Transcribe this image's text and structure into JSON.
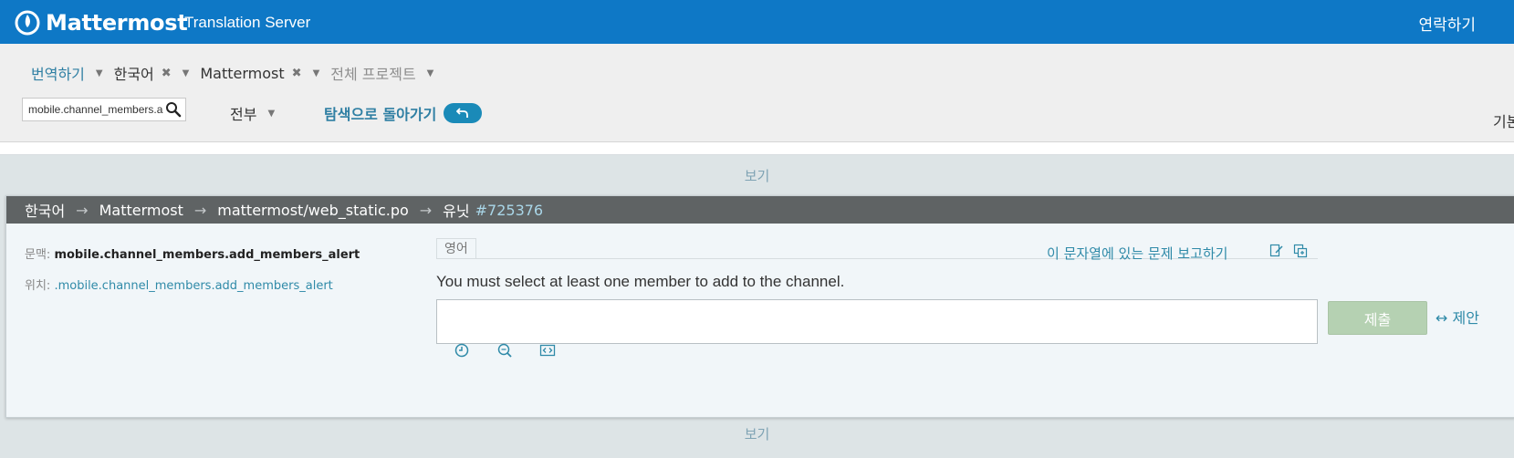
{
  "header": {
    "brand": "Mattermost",
    "server_name": "Translation Server",
    "contact_label": "연락하기",
    "bar_color": "#0e78c6"
  },
  "nav": {
    "crumbs": [
      {
        "label": "번역하기",
        "has_remove": false
      },
      {
        "label": "한국어",
        "has_remove": true
      },
      {
        "label": "Mattermost",
        "has_remove": true
      },
      {
        "label": "전체 프로젝트",
        "has_remove": false
      }
    ],
    "search_value": "mobile.channel_members.a",
    "filter_label": "전부",
    "back_label": "탐색으로 돌아가기",
    "right_cut_text": "기본"
  },
  "view_label": "보기",
  "unit": {
    "path": [
      "한국어",
      "Mattermost",
      "mattermost/web_static.po"
    ],
    "unit_word": "유닛",
    "unit_id": "#725376",
    "context_label": "문맥:",
    "context_value": "mobile.channel_members.add_members_alert",
    "location_label": "위치:",
    "location_value": ".mobile.channel_members.add_members_alert",
    "source_tab": "영어",
    "report_label": "이 문자열에 있는 문제 보고하기",
    "source_text": "You must select at least one member to add to the channel.",
    "target_value": "",
    "submit_label": "제출",
    "suggest_label": "↔ 제안",
    "icons": [
      "history-icon",
      "search-translations-icon",
      "code-icon"
    ]
  }
}
